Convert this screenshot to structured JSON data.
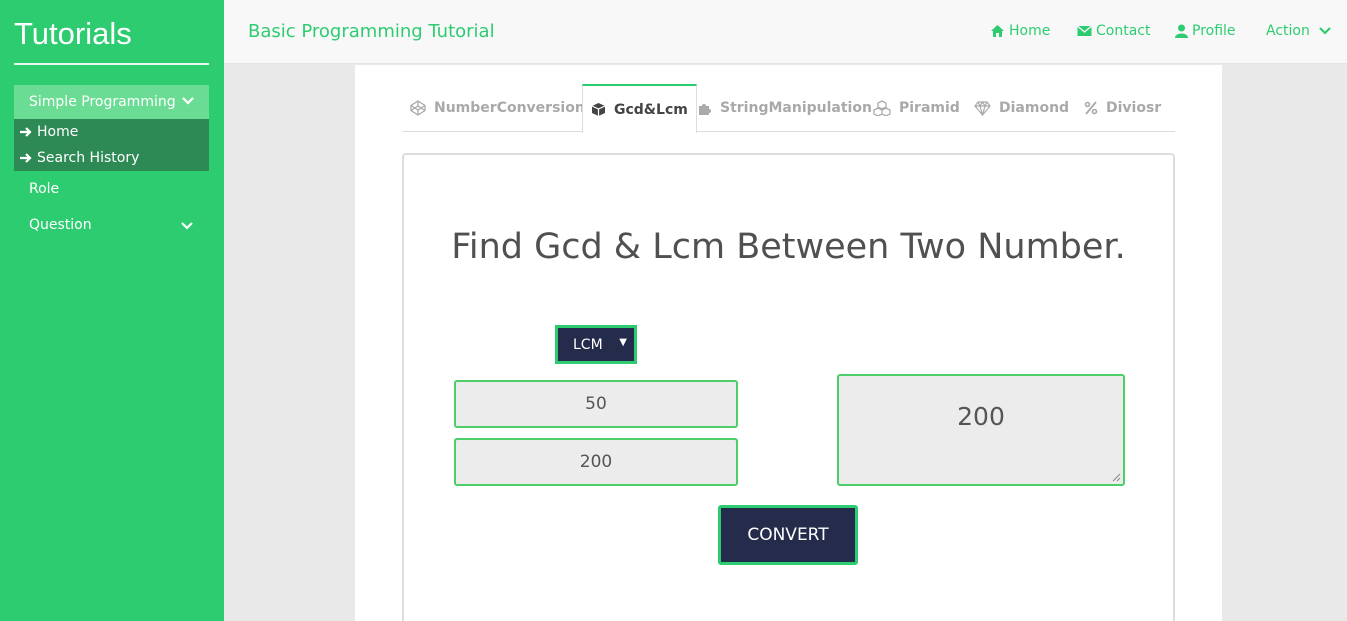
{
  "sidebar": {
    "brand": "Tutorials",
    "group": {
      "label": "Simple Programming",
      "items": [
        {
          "label": "Home"
        },
        {
          "label": "Search History"
        }
      ]
    },
    "role": "Role",
    "question": "Question"
  },
  "header": {
    "title": "Basic Programming Tutorial",
    "nav": {
      "home": "Home",
      "contact": "Contact",
      "profile": "Profile",
      "action": "Action"
    }
  },
  "tabs": [
    {
      "label": "NumberConversion",
      "icon": "codepen-icon"
    },
    {
      "label": "Gcd&Lcm",
      "icon": "cube-icon",
      "active": true
    },
    {
      "label": "StringManipulation",
      "icon": "puzzle-icon"
    },
    {
      "label": "Piramid",
      "icon": "cubes-icon"
    },
    {
      "label": "Diamond",
      "icon": "diamond-icon"
    },
    {
      "label": "Diviosr",
      "icon": "percent-icon"
    }
  ],
  "form": {
    "title": "Find Gcd & Lcm Between Two Number.",
    "mode": "LCM",
    "number1": "50",
    "number2": "200",
    "result": "200",
    "convert_label": "CONVERT"
  },
  "colors": {
    "accent": "#2ecc71",
    "dark_button": "#252b4a",
    "submenu": "#2e8a55"
  }
}
